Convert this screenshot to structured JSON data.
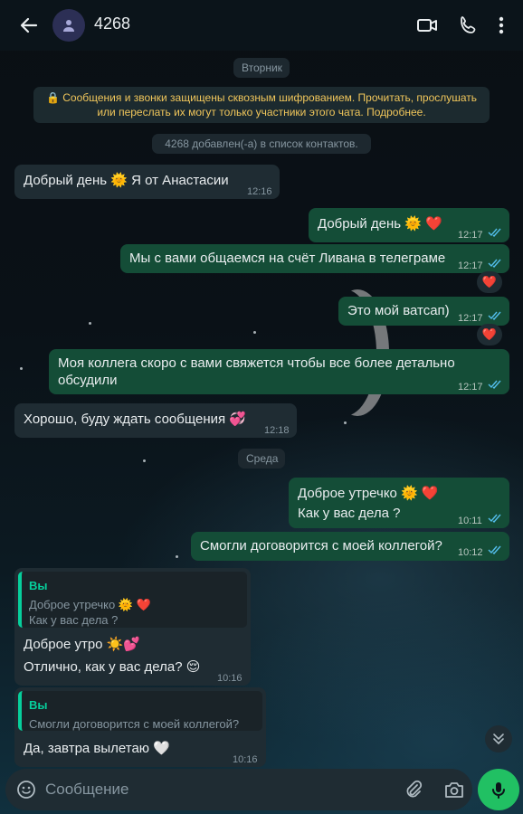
{
  "header": {
    "contact_name": "4268"
  },
  "chat": {
    "day1": "Вторник",
    "encryption_notice": "🔒 Сообщения и звонки защищены сквозным шифрованием. Прочитать, прослушать или переслать их могут только участники этого чата. Подробнее.",
    "contact_added": "4268 добавлен(-а) в список контактов.",
    "messages": [
      {
        "dir": "in",
        "text": "Добрый день 🌞 Я от Анастасии",
        "time": "12:16"
      },
      {
        "dir": "out",
        "text": "Добрый день 🌞 ❤️",
        "time": "12:17"
      },
      {
        "dir": "out",
        "text": "Мы с вами общаемся на счёт Ливана в телеграме",
        "time": "12:17",
        "reaction": "❤️"
      },
      {
        "dir": "out",
        "text": "Это мой ватсап)",
        "time": "12:17",
        "reaction": "❤️"
      },
      {
        "dir": "out",
        "text": "Моя коллега скоро с вами свяжется чтобы все более детально обсудили",
        "time": "12:17"
      },
      {
        "dir": "in",
        "text": "Хорошо, буду ждать сообщения 💞",
        "time": "12:18"
      }
    ],
    "day2": "Среда",
    "messages2": [
      {
        "dir": "out",
        "line1": "Доброе утречко 🌞 ❤️",
        "line2": "Как у вас дела ?",
        "time": "10:11"
      },
      {
        "dir": "out",
        "text": "Смогли договорится с моей коллегой?",
        "time": "10:12"
      },
      {
        "dir": "in",
        "quote_author": "Вы",
        "quote_line1": "Доброе утречко 🌞 ❤️",
        "quote_line2": "Как у вас дела ?",
        "line1": "Доброе утро ☀️💕",
        "line2": "Отлично, как у вас дела? 😌",
        "time": "10:16"
      },
      {
        "dir": "in",
        "quote_author": "Вы",
        "quote_line1": "Смогли договорится с моей коллегой?",
        "line1": "Да, завтра вылетаю 🤍",
        "time": "10:16"
      }
    ]
  },
  "composer": {
    "placeholder": "Сообщение"
  },
  "colors": {
    "accent_green": "#21c063",
    "outgoing_bubble": "#144d37",
    "incoming_bubble": "#1f2c33",
    "read_ticks": "#53bdeb"
  }
}
